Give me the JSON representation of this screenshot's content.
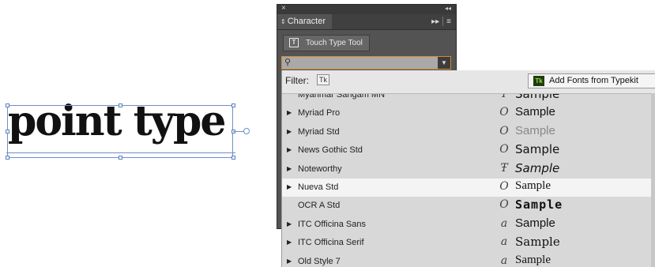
{
  "artboard": {
    "text": "point type"
  },
  "panel": {
    "close_glyph": "×",
    "collapse_glyph": "◂◂",
    "tab_arrows": "⇕",
    "tab_label": "Character",
    "fast_forward_glyph": "▸▸",
    "menu_glyph": "≡",
    "touch_type_label": "Touch Type Tool",
    "touch_type_icon_glyph": "T",
    "search_icon_glyph": "⚲",
    "search_value": "",
    "dropdown_glyph": "▼"
  },
  "dropdown": {
    "filter_label": "Filter:",
    "filter_tk_label": "Tk",
    "add_fonts_label": "Add Fonts from Typekit",
    "tk_logo_text": "Tk",
    "fonts": [
      {
        "expand": "",
        "name": "Myanmar Sangam MN",
        "icon": "Ŧ",
        "sample": "Sample"
      },
      {
        "expand": "▶",
        "name": "Myriad Pro",
        "icon": "O",
        "sample": "Sample"
      },
      {
        "expand": "▶",
        "name": "Myriad Std",
        "icon": "O",
        "sample": "Sample"
      },
      {
        "expand": "▶",
        "name": "News Gothic Std",
        "icon": "O",
        "sample": "Sample"
      },
      {
        "expand": "▶",
        "name": "Noteworthy",
        "icon": "Ŧ",
        "sample": "Sample"
      },
      {
        "expand": "▶",
        "name": "Nueva Std",
        "icon": "O",
        "sample": "Sample"
      },
      {
        "expand": "",
        "name": "OCR A Std",
        "icon": "O",
        "sample": "Sample"
      },
      {
        "expand": "▶",
        "name": "ITC Officina Sans",
        "icon": "a",
        "sample": "Sample"
      },
      {
        "expand": "▶",
        "name": "ITC Officina Serif",
        "icon": "a",
        "sample": "Sample"
      },
      {
        "expand": "▶",
        "name": "Old Style 7",
        "icon": "a",
        "sample": "Sample"
      }
    ]
  },
  "colors": {
    "panel_bg": "#535353",
    "search_focus": "#d48a2b",
    "selection": "#6f8fc8",
    "highlight_row": "#f4f4f4"
  }
}
